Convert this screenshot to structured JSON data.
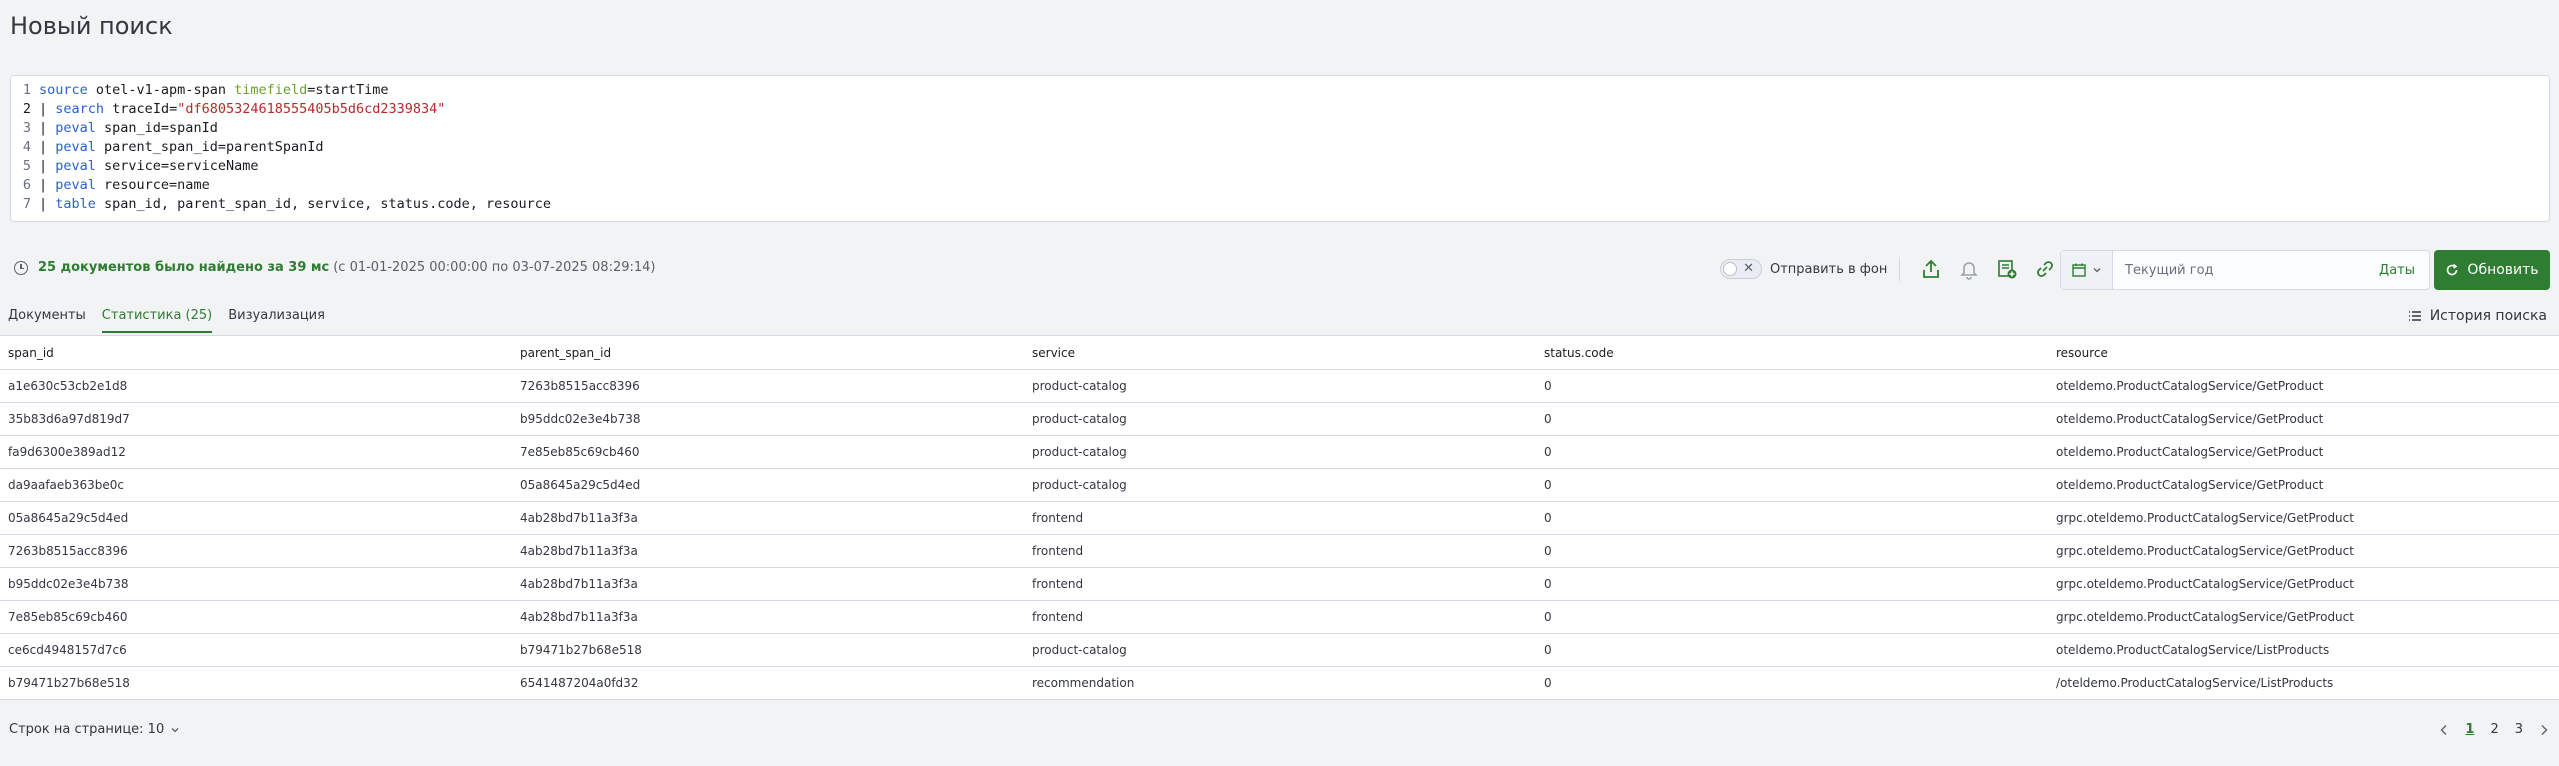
{
  "page": {
    "title": "Новый поиск"
  },
  "query": {
    "lines": [
      {
        "num": "1",
        "parts": [
          {
            "t": "source",
            "c": "kw-blue"
          },
          {
            "t": " otel-v1-apm-span ",
            "c": "txt"
          },
          {
            "t": "timefield",
            "c": "kw-green"
          },
          {
            "t": "=startTime",
            "c": "txt"
          }
        ]
      },
      {
        "num": "2",
        "parts": [
          {
            "t": "| ",
            "c": "txt"
          },
          {
            "t": "search",
            "c": "kw-blue"
          },
          {
            "t": " traceId=",
            "c": "txt"
          },
          {
            "t": "\"df6805324618555405b5d6cd2339834\"",
            "c": "str"
          }
        ]
      },
      {
        "num": "3",
        "parts": [
          {
            "t": "| ",
            "c": "txt"
          },
          {
            "t": "peval",
            "c": "kw-blue"
          },
          {
            "t": " span_id=spanId",
            "c": "txt"
          }
        ]
      },
      {
        "num": "4",
        "parts": [
          {
            "t": "| ",
            "c": "txt"
          },
          {
            "t": "peval",
            "c": "kw-blue"
          },
          {
            "t": " parent_span_id=parentSpanId",
            "c": "txt"
          }
        ]
      },
      {
        "num": "5",
        "parts": [
          {
            "t": "| ",
            "c": "txt"
          },
          {
            "t": "peval",
            "c": "kw-blue"
          },
          {
            "t": " service=serviceName",
            "c": "txt"
          }
        ]
      },
      {
        "num": "6",
        "parts": [
          {
            "t": "| ",
            "c": "txt"
          },
          {
            "t": "peval",
            "c": "kw-blue"
          },
          {
            "t": " resource=name",
            "c": "txt"
          }
        ]
      },
      {
        "num": "7",
        "parts": [
          {
            "t": "| ",
            "c": "txt"
          },
          {
            "t": "table",
            "c": "kw-blue"
          },
          {
            "t": " span_id, parent_span_id, service, status.code, resource",
            "c": "txt"
          }
        ]
      }
    ]
  },
  "status": {
    "found_text": "25 документов было найдено за 39 мс",
    "range_text": "(с 01-01-2025 00:00:00 по 03-07-2025 08:29:14)"
  },
  "toolbar": {
    "background_label": "Отправить в фон",
    "date_value": "Текущий год",
    "dates_link": "Даты",
    "refresh_label": "Обновить"
  },
  "tabs": [
    {
      "label": "Документы",
      "active": false
    },
    {
      "label": "Статистика (25)",
      "active": true
    },
    {
      "label": "Визуализация",
      "active": false
    }
  ],
  "history_label": "История поиска",
  "table": {
    "columns": [
      "span_id",
      "parent_span_id",
      "service",
      "status.code",
      "resource"
    ],
    "rows": [
      [
        "a1e630c53cb2e1d8",
        "7263b8515acc8396",
        "product-catalog",
        "0",
        "oteldemo.ProductCatalogService/GetProduct"
      ],
      [
        "35b83d6a97d819d7",
        "b95ddc02e3e4b738",
        "product-catalog",
        "0",
        "oteldemo.ProductCatalogService/GetProduct"
      ],
      [
        "fa9d6300e389ad12",
        "7e85eb85c69cb460",
        "product-catalog",
        "0",
        "oteldemo.ProductCatalogService/GetProduct"
      ],
      [
        "da9aafaeb363be0c",
        "05a8645a29c5d4ed",
        "product-catalog",
        "0",
        "oteldemo.ProductCatalogService/GetProduct"
      ],
      [
        "05a8645a29c5d4ed",
        "4ab28bd7b11a3f3a",
        "frontend",
        "0",
        "grpc.oteldemo.ProductCatalogService/GetProduct"
      ],
      [
        "7263b8515acc8396",
        "4ab28bd7b11a3f3a",
        "frontend",
        "0",
        "grpc.oteldemo.ProductCatalogService/GetProduct"
      ],
      [
        "b95ddc02e3e4b738",
        "4ab28bd7b11a3f3a",
        "frontend",
        "0",
        "grpc.oteldemo.ProductCatalogService/GetProduct"
      ],
      [
        "7e85eb85c69cb460",
        "4ab28bd7b11a3f3a",
        "frontend",
        "0",
        "grpc.oteldemo.ProductCatalogService/GetProduct"
      ],
      [
        "ce6cd4948157d7c6",
        "b79471b27b68e518",
        "product-catalog",
        "0",
        "oteldemo.ProductCatalogService/ListProducts"
      ],
      [
        "b79471b27b68e518",
        "6541487204a0fd32",
        "recommendation",
        "0",
        "/oteldemo.ProductCatalogService/ListProducts"
      ]
    ]
  },
  "footer": {
    "rows_per_page_label": "Строк на странице: 10",
    "pages": [
      "1",
      "2",
      "3"
    ],
    "current_page": "1"
  }
}
